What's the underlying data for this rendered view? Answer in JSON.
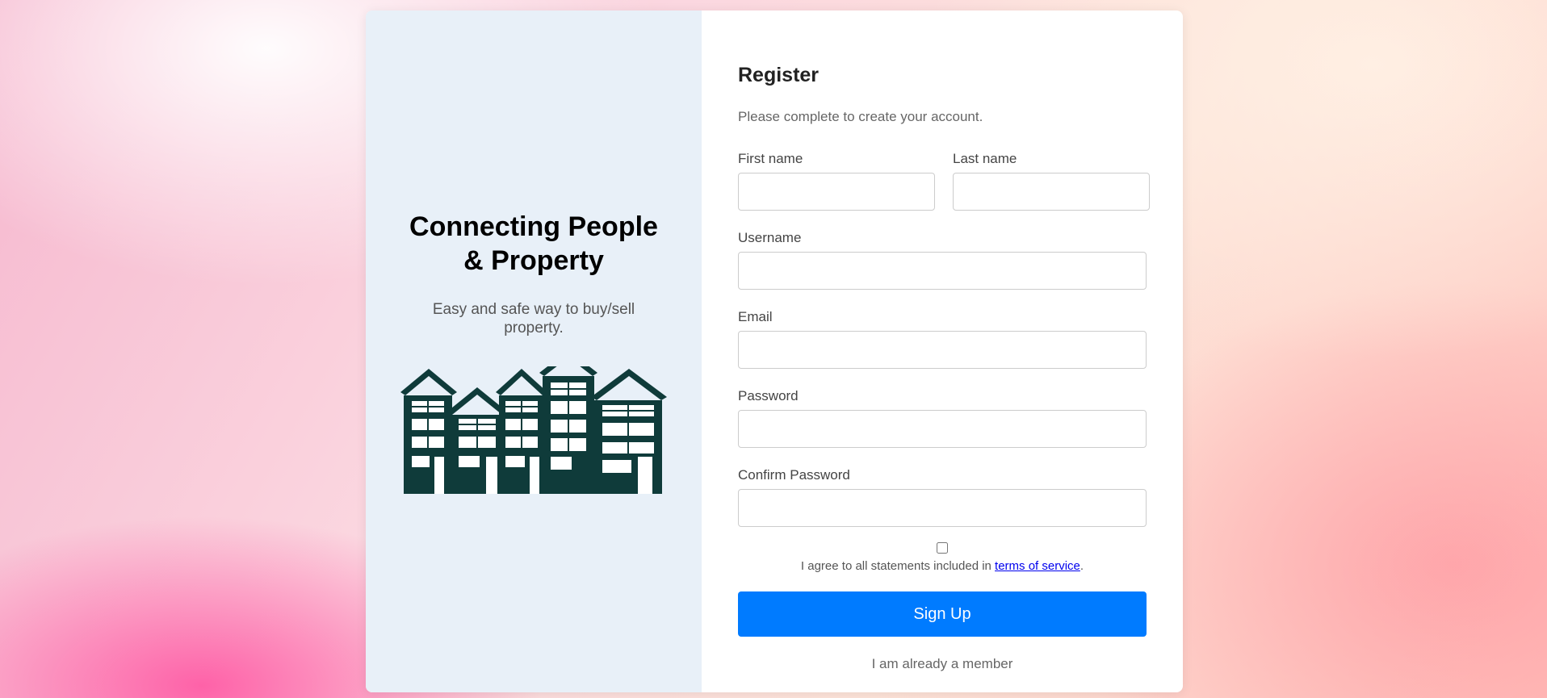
{
  "brand": {
    "headline": "Connecting People & Property",
    "tagline": "Easy and safe way to buy/sell property.",
    "illustration": "buildings-illustration",
    "illustration_color": "#0f3b3a"
  },
  "form": {
    "title": "Register",
    "subtitle": "Please complete to create your account.",
    "first_name_label": "First name",
    "first_name_value": "",
    "last_name_label": "Last name",
    "last_name_value": "",
    "username_label": "Username",
    "username_value": "",
    "email_label": "Email",
    "email_value": "",
    "password_label": "Password",
    "password_value": "",
    "confirm_password_label": "Confirm Password",
    "confirm_password_value": "",
    "terms_checked": false,
    "terms_text": "I agree to all statements included in ",
    "terms_link": "terms of service",
    "terms_end": ".",
    "submit_label": "Sign Up",
    "member_link": "I am already a member"
  },
  "colors": {
    "accent": "#007bff",
    "left_panel": "#e8f0f8"
  }
}
